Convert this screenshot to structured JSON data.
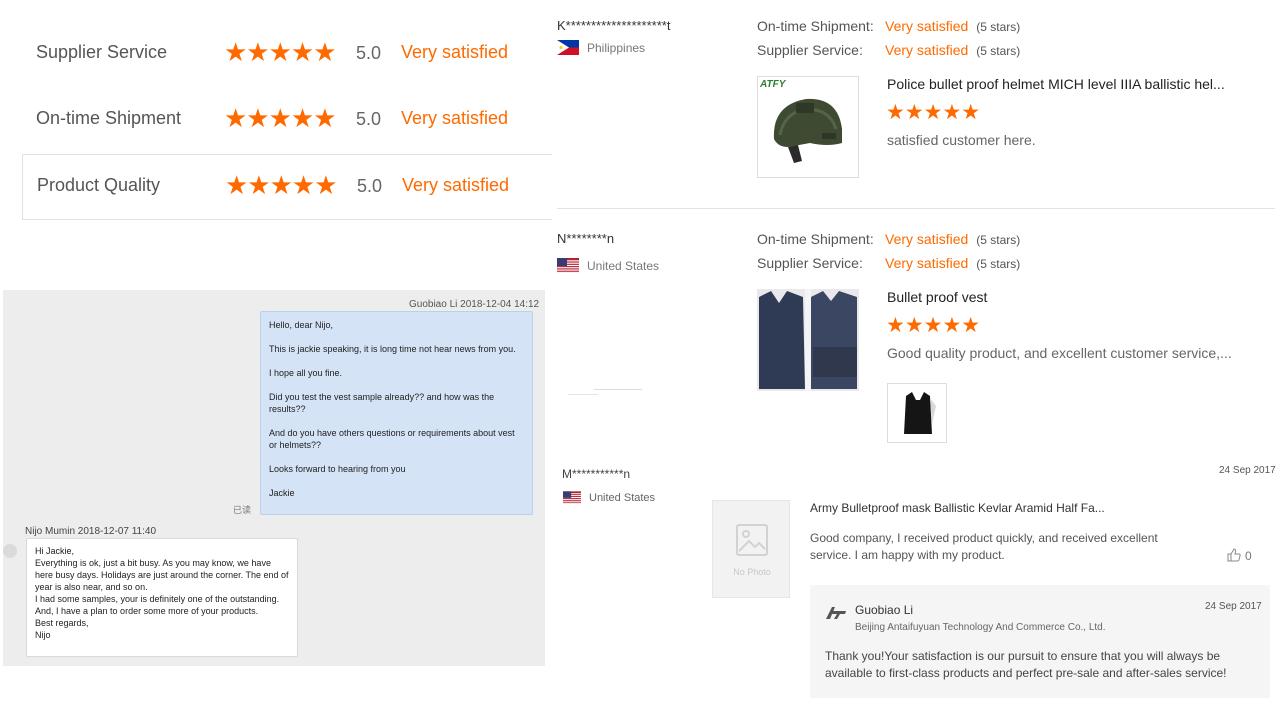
{
  "summary": {
    "rows": [
      {
        "label": "Supplier Service",
        "stars": "★★★★★",
        "score": "5.0",
        "text": "Very satisfied"
      },
      {
        "label": "On-time Shipment",
        "stars": "★★★★★",
        "score": "5.0",
        "text": "Very satisfied"
      },
      {
        "label": "Product Quality",
        "stars": "★★★★★",
        "score": "5.0",
        "text": "Very satisfied"
      }
    ]
  },
  "chat": {
    "header_out": "Guobiao Li   2018-12-04 14:12",
    "out_lines": [
      "Hello, dear Nijo,",
      "This is jackie speaking, it is long time not hear news from you.",
      "I hope all you fine.",
      "Did you test the vest sample already?? and how was the results??",
      "And do you have others questions or requirements about vest or helmets??",
      "Looks forward to hearing from you",
      "Jackie"
    ],
    "read_mark": "已读",
    "header_in": "Nijo Mumin   2018-12-07 11:40",
    "in_lines": [
      "Hi Jackie,",
      "Everything is ok, just a bit busy. As you may know, we have here busy days. Holidays are just around the corner. The end of year is also near, and so on.",
      "I had some samples, your is definitely one of the outstanding.",
      "And, I have a plan to order some more of your products.",
      "Best regards,",
      "Nijo"
    ]
  },
  "reviews": [
    {
      "name": "K********************t",
      "country": "Philippines",
      "shipment_label": "On-time Shipment:",
      "shipment_value": "Very satisfied",
      "shipment_stars": "(5 stars)",
      "service_label": "Supplier Service:",
      "service_value": "Very satisfied",
      "service_stars": "(5 stars)",
      "title": "Police bullet proof helmet MICH level IIIA ballistic hel...",
      "stars": "★★★★★",
      "comment": "satisfied customer here.",
      "thumb_logo": "ATFY"
    },
    {
      "name": "N********n",
      "country": "United States",
      "shipment_label": "On-time Shipment:",
      "shipment_value": "Very satisfied",
      "shipment_stars": "(5 stars)",
      "service_label": "Supplier Service:",
      "service_value": "Very satisfied",
      "service_stars": "(5 stars)",
      "title": "Bullet proof vest",
      "stars": "★★★★★",
      "comment": "Good quality product, and excellent customer service,..."
    }
  ],
  "review3": {
    "name": "M***********n",
    "country": "United States",
    "date": "24 Sep 2017",
    "no_photo": "No Photo",
    "title": "Army Bulletproof mask Ballistic Kevlar Aramid Half Fa...",
    "comment": "Good company, I received product quickly, and received excellent service. I am happy with my product.",
    "likes": "0",
    "reply": {
      "name": "Guobiao Li",
      "company": "Beijing Antaifuyuan Technology And Commerce Co., Ltd.",
      "date": "24 Sep 2017",
      "text": "Thank you!Your satisfaction is our pursuit to ensure that you will always be available to first-class products and perfect pre-sale and after-sales service!"
    }
  },
  "colors": {
    "accent": "#ff6a00",
    "chat_out": "#d4e3f5",
    "chat_bg": "#ededed"
  }
}
